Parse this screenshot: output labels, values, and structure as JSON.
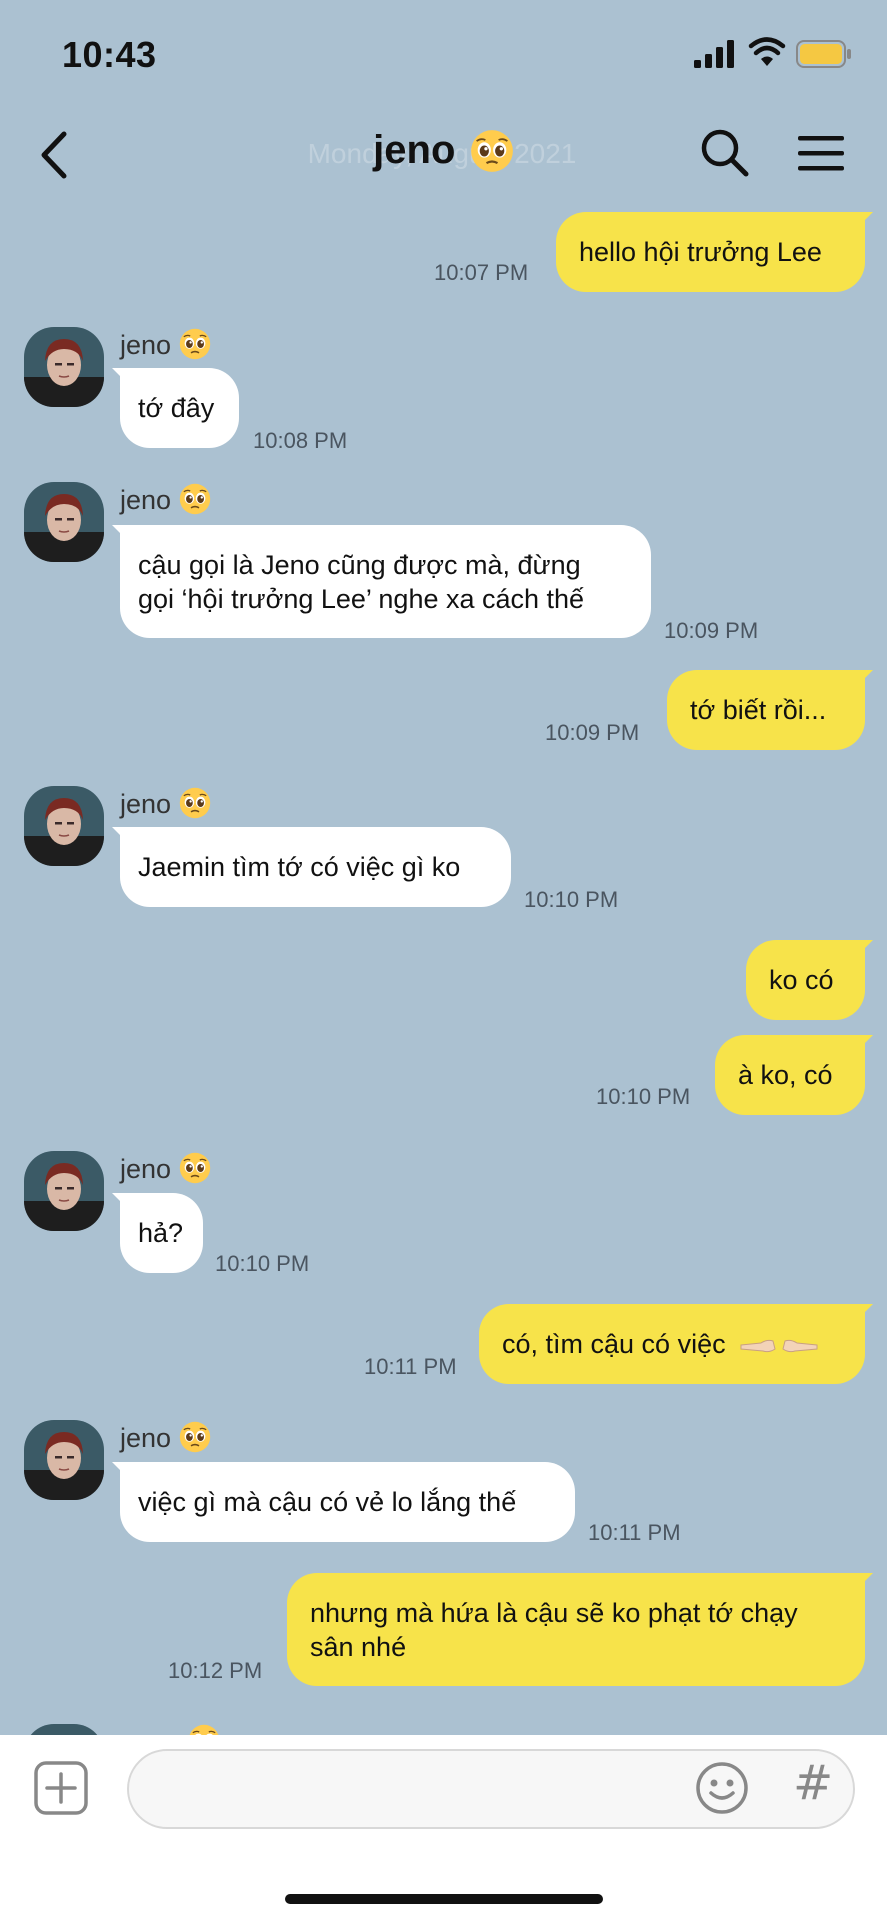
{
  "status_bar": {
    "time": "10:43"
  },
  "header": {
    "title": "jeno",
    "title_emoji": "pleading-face-emoji",
    "ghost_date": "Monday, August 2021",
    "back_icon": "chevron-left-icon",
    "search_icon": "search-icon",
    "menu_icon": "hamburger-menu-icon"
  },
  "contact": {
    "name": "jeno",
    "emoji": "pleading-face-emoji"
  },
  "messages": [
    {
      "from": "me",
      "text": "hello hội trưởng Lee",
      "time": "10:07 PM"
    },
    {
      "from": "them",
      "text": "tớ đây",
      "time": "10:08 PM"
    },
    {
      "from": "them",
      "line1": "cậu gọi là Jeno cũng được mà, đừng",
      "line2": "gọi ‘hội trưởng Lee’ nghe xa cách thế",
      "time": "10:09 PM"
    },
    {
      "from": "me",
      "text": "tớ biết rồi...",
      "time": "10:09 PM"
    },
    {
      "from": "them",
      "text": "Jaemin tìm tớ có việc gì ko",
      "time": "10:10 PM"
    },
    {
      "from": "me",
      "text": "ko có",
      "time": ""
    },
    {
      "from": "me",
      "text": "à ko, có",
      "time": "10:10 PM"
    },
    {
      "from": "them",
      "text": "hả?",
      "time": "10:10 PM"
    },
    {
      "from": "me",
      "text": "có, tìm cậu có việc",
      "emoji": "pointing-fingers-emoji",
      "time": "10:11 PM"
    },
    {
      "from": "them",
      "text": "việc gì mà cậu có vẻ lo lắng thế",
      "time": "10:11 PM"
    },
    {
      "from": "me",
      "line1": "nhưng mà hứa là cậu sẽ ko phạt tớ chạy",
      "line2": "sân nhé",
      "time": "10:12 PM"
    }
  ],
  "composer": {
    "plus_icon": "plus-square-icon",
    "emoji_icon": "smiley-icon",
    "hash_symbol": "#"
  },
  "colors": {
    "background": "#abc1d1",
    "my_bubble": "#f7e34a",
    "their_bubble": "#ffffff",
    "battery": "#f5c842"
  }
}
